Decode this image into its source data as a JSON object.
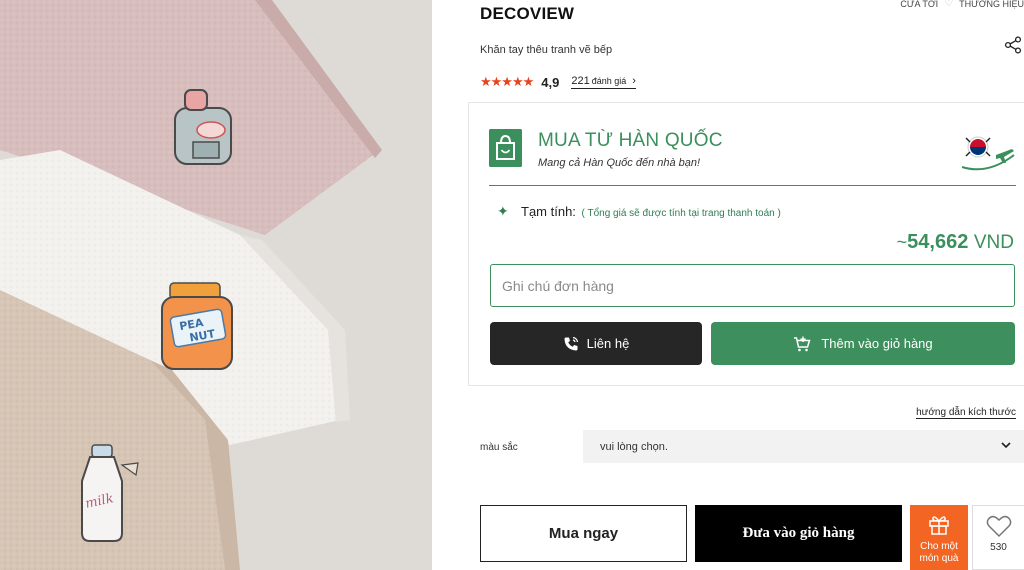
{
  "top_links": {
    "store": "CỬA TỚI",
    "brand": "THƯƠNG HIỆU"
  },
  "product": {
    "brand": "DECOVIEW",
    "subtitle": "Khăn tay thêu tranh vẽ bếp",
    "stars": "★★★★★",
    "rating": "4,9",
    "review_count": "221",
    "review_label": "đánh giá",
    "review_chevron": "›"
  },
  "korea_box": {
    "title": "MUA TỪ HÀN QUỐC",
    "subtitle": "Mang cả Hàn Quốc đến nhà bạn!",
    "estimate_label": "Tạm tính:",
    "estimate_note": "( Tổng giá sẽ được tính tại trang thanh toán )",
    "price_prefix": "~",
    "price_value": "54,662",
    "price_currency": "VND",
    "note_placeholder": "Ghi chú đơn hàng",
    "contact_label": "Liên hệ",
    "add_cart_label": "Thêm vào giỏ hàng",
    "accent_color": "#3b8f5c"
  },
  "options": {
    "size_guide": "hướng dẫn kích thước",
    "color_label": "màu sắc",
    "color_value": "vui lòng chọn.",
    "color_chevron": "⌄"
  },
  "actions": {
    "buy_now": "Mua ngay",
    "add_to_cart": "Đưa vào giỏ hàng",
    "gift_label": "Cho một món quà",
    "wish_count": "530",
    "gift_color": "#f26522"
  },
  "photo": {
    "jar_label_top": "PEA",
    "jar_label_bottom": "NUT",
    "milk_label": "milk"
  }
}
